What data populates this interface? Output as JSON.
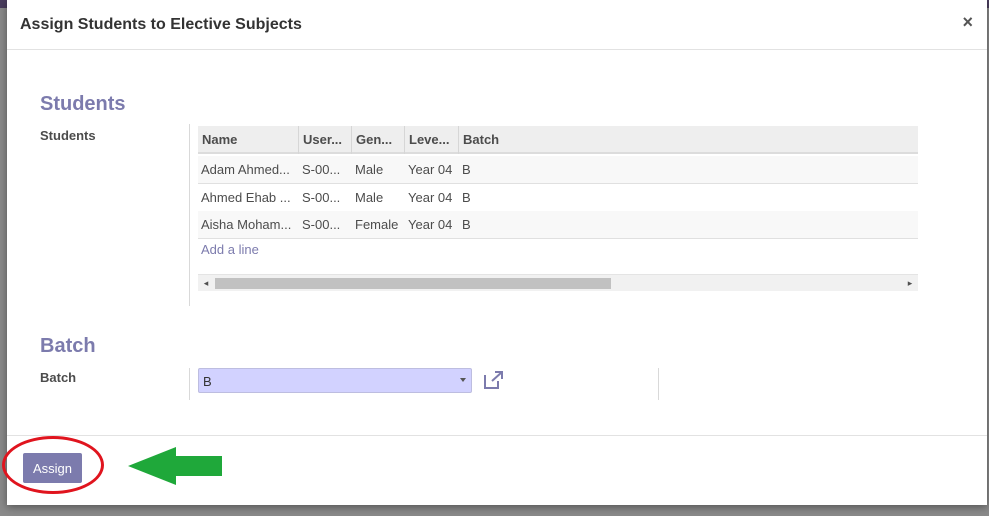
{
  "modal": {
    "title": "Assign Students to Elective Subjects",
    "close_label": "×"
  },
  "students_section": {
    "title": "Students",
    "field_label": "Students",
    "columns": [
      "Name",
      "User...",
      "Gen...",
      "Leve...",
      "Batch"
    ],
    "rows": [
      [
        "Adam Ahmed...",
        "S-00...",
        "Male",
        "Year 04",
        "B"
      ],
      [
        "Ahmed Ehab ...",
        "S-00...",
        "Male",
        "Year 04",
        "B"
      ],
      [
        "Aisha Moham...",
        "S-00...",
        "Female",
        "Year 04",
        "B"
      ]
    ],
    "add_line": "Add a line",
    "scroll_left": "◂",
    "scroll_right": "▸"
  },
  "batch_section": {
    "title": "Batch",
    "field_label": "Batch",
    "selected_value": "B",
    "link_icon": "external-link-icon"
  },
  "footer": {
    "assign_label": "Assign"
  },
  "annotations": {
    "highlight_color": "#e0141e",
    "arrow_color": "#1fa83a"
  },
  "colors": {
    "accent": "#7c7bad",
    "select_bg": "#d2d2ff"
  }
}
